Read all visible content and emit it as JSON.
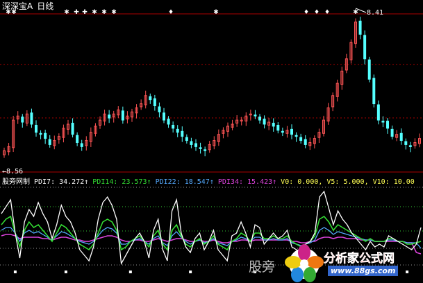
{
  "app": {
    "title": "深深宝A",
    "timeframe": "日线"
  },
  "price_panel": {
    "high_label": "8.41",
    "low_label": "8.56"
  },
  "indicator_panel": {
    "name": "股旁网制",
    "items": [
      {
        "label": "PDI7: 34.272↑",
        "color": "#ffffff"
      },
      {
        "label": "PDI14: 23.573↑",
        "color": "#33dd33"
      },
      {
        "label": "PDI22: 18.547↑",
        "color": "#55aaff"
      },
      {
        "label": "PDI34: 15.423↑",
        "color": "#dd44dd"
      },
      {
        "label": "V0: 0.000,",
        "color": "#ffff55"
      },
      {
        "label": "V5: 5.000,",
        "color": "#ffff55"
      },
      {
        "label": "V10: 10.00",
        "color": "#ffff55"
      }
    ]
  },
  "watermarks": {
    "left_text": "股旁",
    "brand": "分析家公式网",
    "url": "www.88gs.com"
  },
  "colors": {
    "up": "#ff5555",
    "down": "#55ffff",
    "background": "#000000",
    "grid": "#aa0000"
  },
  "chart_data": [
    {
      "type": "candlestick",
      "title": "深深宝A 日线",
      "marked_high": 8.41,
      "marked_low": 8.56,
      "closes": [
        6.1,
        6.3,
        7.6,
        7.8,
        7.5,
        7.9,
        7.4,
        7.0,
        6.9,
        6.7,
        6.4,
        6.6,
        6.8,
        7.2,
        7.4,
        6.9,
        6.5,
        6.3,
        6.6,
        7.0,
        7.3,
        7.6,
        7.9,
        7.7,
        7.9,
        8.1,
        7.6,
        7.8,
        8.0,
        8.2,
        8.4,
        8.8,
        8.6,
        8.3,
        8.0,
        7.6,
        7.4,
        7.2,
        7.0,
        6.8,
        6.6,
        6.4,
        6.3,
        6.2,
        6.1,
        6.4,
        6.6,
        6.9,
        7.1,
        7.3,
        7.4,
        7.6,
        7.6,
        7.8,
        7.9,
        7.8,
        7.6,
        7.4,
        7.5,
        7.3,
        7.1,
        7.0,
        7.1,
        6.9,
        6.8,
        6.6,
        6.4,
        6.5,
        6.7,
        7.0,
        7.6,
        8.2,
        8.8,
        9.4,
        10.0,
        10.6,
        11.4,
        12.4,
        11.8,
        10.6,
        9.6,
        8.4,
        7.6,
        7.5,
        7.2,
        6.8,
        6.9,
        6.6,
        6.4,
        6.3,
        6.5,
        6.7
      ],
      "markers_top": [
        "✱",
        "✱",
        "✱",
        "✚",
        "✚",
        "✱",
        "✱",
        "✱",
        "♦",
        "✱",
        "♦",
        "♦",
        "♦",
        "✱"
      ]
    },
    {
      "type": "line",
      "title": "股旁网制",
      "series": [
        {
          "name": "PDI7",
          "values": [
            44,
            49,
            54,
            30,
            12,
            38,
            47,
            42,
            52,
            44,
            38,
            26,
            36,
            50,
            42,
            38,
            30,
            18,
            14,
            10,
            20,
            40,
            52,
            56,
            50,
            40,
            8,
            14,
            20,
            26,
            30,
            24,
            12,
            32,
            40,
            18,
            10,
            46,
            54,
            30,
            20,
            16,
            26,
            30,
            18,
            24,
            32,
            18,
            14,
            10,
            28,
            30,
            38,
            30,
            20,
            36,
            34,
            22,
            26,
            30,
            26,
            28,
            32,
            20,
            18,
            16,
            22,
            24,
            30,
            56,
            60,
            48,
            36,
            46,
            40,
            36,
            30,
            26,
            22,
            18,
            24,
            20,
            22,
            20,
            28,
            26,
            24,
            22,
            20,
            18,
            22,
            34
          ]
        },
        {
          "name": "PDI14",
          "values": [
            36,
            40,
            42,
            30,
            20,
            32,
            38,
            34,
            36,
            32,
            28,
            24,
            30,
            36,
            34,
            30,
            26,
            22,
            20,
            18,
            22,
            30,
            38,
            40,
            38,
            32,
            18,
            20,
            24,
            26,
            28,
            24,
            20,
            28,
            32,
            22,
            18,
            32,
            36,
            28,
            22,
            20,
            24,
            26,
            22,
            24,
            28,
            22,
            20,
            18,
            24,
            26,
            30,
            28,
            24,
            30,
            30,
            26,
            26,
            28,
            26,
            26,
            28,
            24,
            22,
            20,
            22,
            24,
            28,
            40,
            42,
            38,
            32,
            36,
            34,
            32,
            30,
            28,
            26,
            24,
            26,
            24,
            24,
            24,
            26,
            26,
            24,
            24,
            22,
            22,
            23,
            24
          ]
        },
        {
          "name": "PDI22",
          "values": [
            32,
            34,
            34,
            30,
            24,
            30,
            32,
            30,
            31,
            29,
            27,
            25,
            28,
            31,
            30,
            28,
            26,
            24,
            23,
            22,
            24,
            28,
            32,
            34,
            33,
            30,
            22,
            22,
            24,
            25,
            26,
            24,
            22,
            26,
            28,
            23,
            21,
            28,
            31,
            27,
            24,
            22,
            24,
            25,
            23,
            24,
            26,
            23,
            22,
            21,
            24,
            25,
            27,
            26,
            24,
            27,
            27,
            25,
            25,
            26,
            25,
            25,
            26,
            23,
            22,
            21,
            22,
            23,
            25,
            32,
            34,
            32,
            29,
            31,
            30,
            29,
            28,
            27,
            26,
            25,
            25,
            24,
            24,
            24,
            25,
            25,
            24,
            24,
            23,
            23,
            23,
            19
          ]
        },
        {
          "name": "PDI34",
          "values": [
            28,
            29,
            29,
            28,
            26,
            27,
            27,
            27,
            27,
            26,
            26,
            25,
            26,
            27,
            27,
            26,
            25,
            25,
            24,
            24,
            25,
            26,
            27,
            28,
            28,
            27,
            25,
            24,
            24,
            25,
            25,
            24,
            24,
            25,
            26,
            25,
            24,
            25,
            26,
            26,
            25,
            24,
            24,
            25,
            24,
            24,
            25,
            24,
            23,
            23,
            24,
            24,
            25,
            25,
            24,
            25,
            25,
            25,
            25,
            25,
            25,
            25,
            25,
            24,
            24,
            23,
            23,
            24,
            24,
            26,
            27,
            27,
            26,
            27,
            27,
            26,
            26,
            26,
            25,
            25,
            25,
            24,
            24,
            24,
            24,
            24,
            24,
            24,
            23,
            23,
            16,
            15
          ]
        },
        {
          "name": "V0",
          "value": 0
        },
        {
          "name": "V5",
          "value": 5
        },
        {
          "name": "V10",
          "value": 10
        }
      ],
      "signal_markers": [
        3,
        14,
        28,
        41,
        55,
        66,
        79,
        88
      ]
    }
  ]
}
